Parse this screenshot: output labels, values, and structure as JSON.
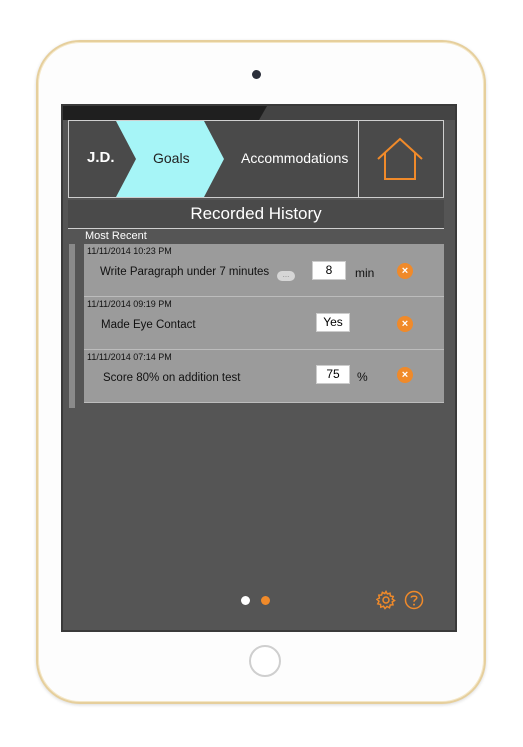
{
  "nav": {
    "initials": "J.D.",
    "tab_goals": "Goals",
    "tab_accommodations": "Accommodations",
    "home_icon": "house-icon"
  },
  "title": "Recorded History",
  "subtitle": "Most Recent",
  "rows": [
    {
      "date": "11/11/2014 10:23 PM",
      "label": "Write Paragraph under 7 minutes",
      "value": "8",
      "unit": "min",
      "has_more": true,
      "more_label": "..."
    },
    {
      "date": "11/11/2014 09:19 PM",
      "label": "Made Eye Contact",
      "value": "Yes",
      "unit": "",
      "has_more": false
    },
    {
      "date": "11/11/2014 07:14 PM",
      "label": "Score 80% on addition test",
      "value": "75",
      "unit": "%",
      "has_more": false
    }
  ],
  "delete_symbol": "×",
  "pager": {
    "current": 2,
    "total": 2
  },
  "icons": {
    "settings": "gear-icon",
    "help": "help-icon"
  },
  "colors": {
    "accent": "#f08a2a",
    "active_tab": "#a6f5f7",
    "screen_bg": "#555555",
    "row_bg": "#9b9b9b"
  }
}
